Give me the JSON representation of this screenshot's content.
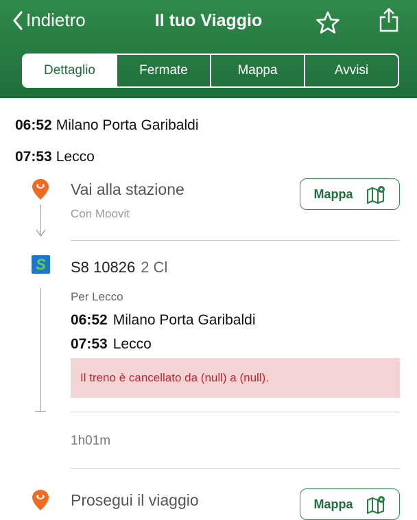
{
  "header": {
    "back_label": "Indietro",
    "title": "Il tuo Viaggio",
    "star_icon": "star-outline-icon",
    "share_icon": "share-icon",
    "tabs": [
      {
        "label": "Dettaglio",
        "selected": true
      },
      {
        "label": "Fermate",
        "selected": false
      },
      {
        "label": "Mappa",
        "selected": false
      },
      {
        "label": "Avvisi",
        "selected": false
      }
    ],
    "background_color": "#2a7d43"
  },
  "journey": {
    "departure": {
      "time": "06:52",
      "station": "Milano Porta Garibaldi"
    },
    "arrival": {
      "time": "07:53",
      "station": "Lecco"
    }
  },
  "steps": [
    {
      "title": "Vai alla stazione",
      "subtitle": "Con Moovit",
      "map_button_label": "Mappa",
      "icon": "location-pin-icon"
    },
    {
      "train": "S8 10826",
      "class": "2 Cl",
      "direction": "Per Lecco",
      "departure": {
        "time": "06:52",
        "station": "Milano Porta Garibaldi"
      },
      "arrival": {
        "time": "07:53",
        "station": "Lecco"
      },
      "alert": "Il treno è cancellato da (null) a (null).",
      "badge_letter": "S",
      "duration": "1h01m"
    },
    {
      "title": "Prosegui il viaggio",
      "map_button_label": "Mappa",
      "icon": "location-pin-icon"
    }
  ],
  "colors": {
    "accent": "#2a7d43",
    "alert_bg": "#f4d3d5",
    "alert_text": "#c0262e",
    "pin": "#f06a24",
    "badge_blue": "#1f76c8",
    "badge_green": "#5bd455"
  }
}
